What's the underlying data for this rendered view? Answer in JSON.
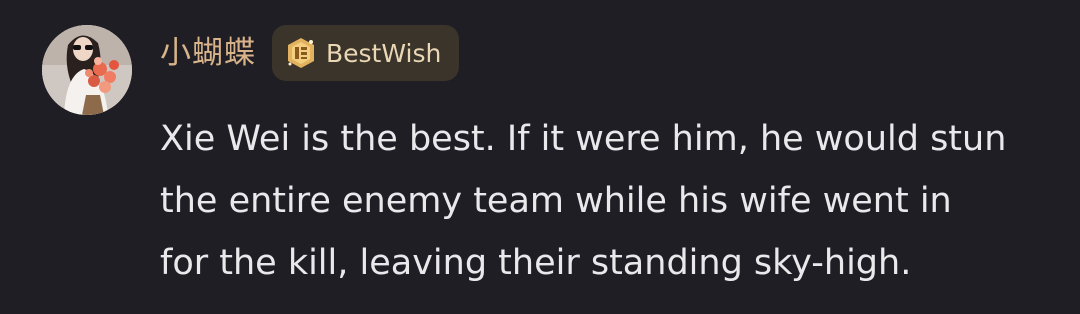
{
  "comment": {
    "author": {
      "name": "小蝴蝶",
      "avatar_icon": "user-avatar-photo"
    },
    "badge": {
      "label": "BestWish",
      "icon": "bestwish-badge-icon",
      "background": "#3a342b",
      "text_color": "#ead7b4"
    },
    "text_lines": [
      "Xie Wei is the best. If it were him, he would stun",
      "the entire enemy team while his wife went in",
      "for the kill, leaving their standing sky-high."
    ]
  },
  "colors": {
    "background": "#1f1e24",
    "username": "#d9b48a",
    "body_text": "#e9e9ec"
  }
}
